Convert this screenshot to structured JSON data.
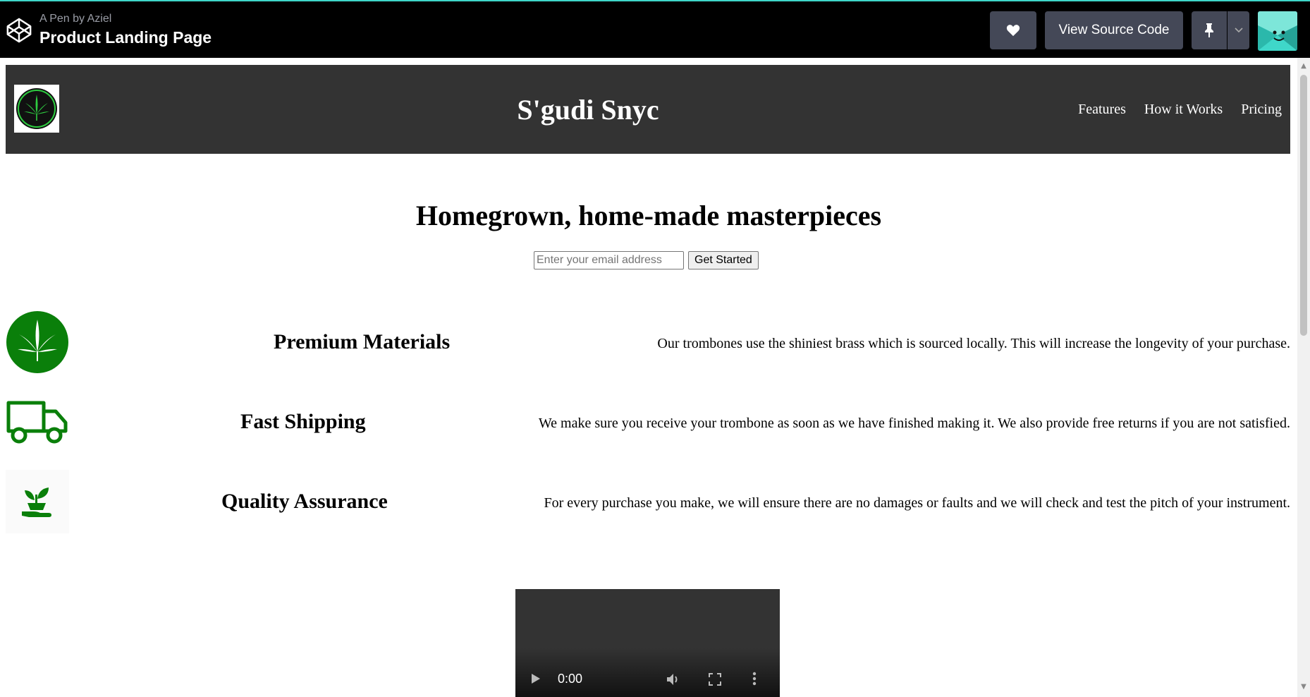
{
  "codepen": {
    "author_line": "A Pen by Aziel",
    "title": "Product Landing Page",
    "view_source_label": "View Source Code",
    "heart_icon": "heart-icon",
    "pin_icon": "pin-icon",
    "accent": "#3fd7c9"
  },
  "page": {
    "brand": "S'gudi Snyc",
    "nav": [
      "Features",
      "How it Works",
      "Pricing"
    ],
    "hero_title": "Homegrown, home-made masterpieces",
    "email_placeholder": "Enter your email address",
    "submit_label": "Get Started",
    "header_bg": "#333333",
    "brand_green": "#0a7f0a"
  },
  "features": [
    {
      "icon": "leaf-icon",
      "title": "Premium Materials",
      "description": "Our trombones use the shiniest brass which is sourced locally. This will increase the longevity of your purchase."
    },
    {
      "icon": "truck-icon",
      "title": "Fast Shipping",
      "description": "We make sure you receive your trombone as soon as we have finished making it. We also provide free returns if you are not satisfied."
    },
    {
      "icon": "plant-hand-icon",
      "title": "Quality Assurance",
      "description": "For every purchase you make, we will ensure there are no damages or faults and we will check and test the pitch of your instrument."
    }
  ],
  "video": {
    "time": "0:00"
  }
}
